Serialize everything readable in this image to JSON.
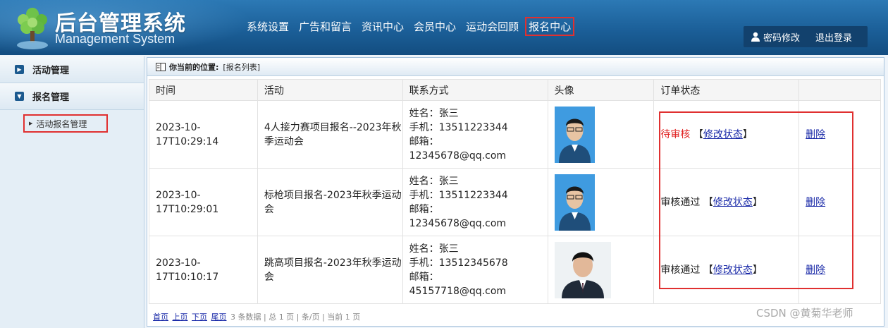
{
  "header": {
    "title": "后台管理系统",
    "subtitle": "Management System",
    "nav": [
      "系统设置",
      "广告和留言",
      "资讯中心",
      "会员中心",
      "运动会回顾",
      "报名中心"
    ],
    "active_nav": "报名中心",
    "password_label": "密码修改",
    "logout_label": "退出登录",
    "user_icon": "user-icon"
  },
  "sidebar": {
    "menus": [
      {
        "label": "活动管理",
        "icon": "collapsed-arrow-icon"
      },
      {
        "label": "报名管理",
        "icon": "expanded-arrow-icon"
      }
    ],
    "sub_item": "活动报名管理"
  },
  "main": {
    "location_label": "你当前的位置:",
    "location_value": "[报名列表]",
    "columns": [
      "时间",
      "活动",
      "联系方式",
      "头像",
      "订单状态",
      ""
    ],
    "rows": [
      {
        "time": "2023-10-17T10:29:14",
        "activity": "4人接力赛项目报名--2023年秋季运动会",
        "name": "姓名：张三",
        "phone": "手机：13511223344",
        "email_label": "邮箱：",
        "email": "12345678@qq.com",
        "status": "待审核",
        "status_color": "#e02020",
        "bracket_open": "【",
        "modify": "修改状态",
        "bracket_close": "】",
        "delete": "删除"
      },
      {
        "time": "2023-10-17T10:29:01",
        "activity": "标枪项目报名-2023年秋季运动会",
        "name": "姓名：张三",
        "phone": "手机：13511223344",
        "email_label": "邮箱：",
        "email": "12345678@qq.com",
        "status": "审核通过",
        "status_color": "#222222",
        "bracket_open": "【",
        "modify": "修改状态",
        "bracket_close": "】",
        "delete": "删除"
      },
      {
        "time": "2023-10-17T10:10:17",
        "activity": "跳高项目报名-2023年秋季运动会",
        "name": "姓名：张三",
        "phone": "手机：13512345678",
        "email_label": "邮箱：",
        "email": "45157718@qq.com",
        "status": "审核通过",
        "status_color": "#222222",
        "bracket_open": "【",
        "modify": "修改状态",
        "bracket_close": "】",
        "delete": "删除"
      }
    ]
  },
  "pager": {
    "first": "首页",
    "prev": "上页",
    "next": "下页",
    "last": "尾页",
    "summary": "3 条数据 | 总 1 页 | 条/页 | 当前 1 页"
  },
  "watermark": "CSDN @黄菊华老师",
  "colors": {
    "header": "#1b5f98",
    "highlight": "#e03030",
    "link": "#1a2aa8"
  }
}
